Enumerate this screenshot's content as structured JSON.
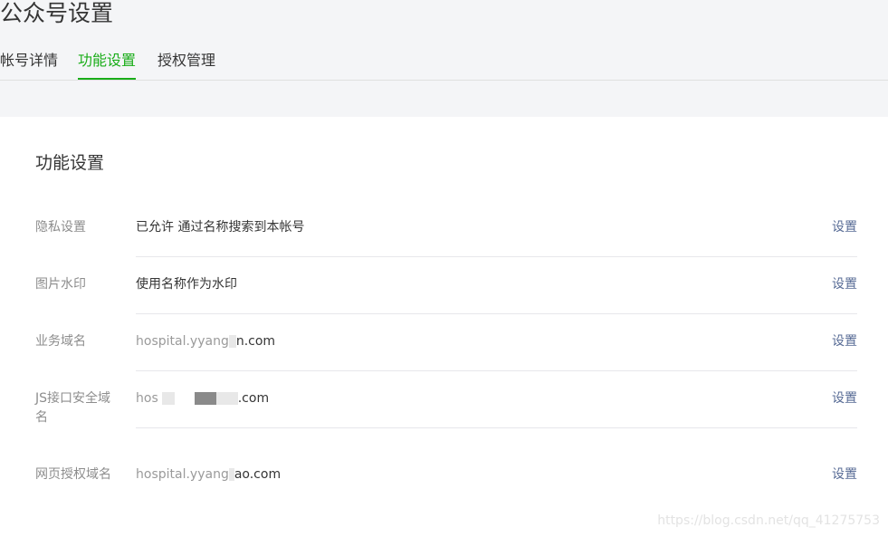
{
  "page": {
    "title": "公众号设置"
  },
  "tabs": [
    {
      "label": "帐号详情",
      "active": false
    },
    {
      "label": "功能设置",
      "active": true
    },
    {
      "label": "授权管理",
      "active": false
    }
  ],
  "section": {
    "title": "功能设置"
  },
  "rows": [
    {
      "label": "隐私设置",
      "value": "已允许 通过名称搜索到本帐号",
      "action": "设置"
    },
    {
      "label": "图片水印",
      "value": "使用名称作为水印",
      "action": "设置"
    },
    {
      "label": "业务域名",
      "value_visible": "hospital.yyang",
      "value_suffix": "n.com",
      "action": "设置"
    },
    {
      "label": "JS接口安全域名",
      "value_visible": "hos",
      "value_suffix": ".com",
      "action": "设置"
    },
    {
      "label": "网页授权域名",
      "value_visible": "hospital.yyang",
      "value_suffix": "ao.com",
      "action": "设置"
    }
  ],
  "watermark": "https://blog.csdn.net/qq_41275753",
  "colors": {
    "accent": "#1aad19",
    "link": "#576b95",
    "muted": "#8d8d8d",
    "header_bg": "#f4f5f7"
  }
}
